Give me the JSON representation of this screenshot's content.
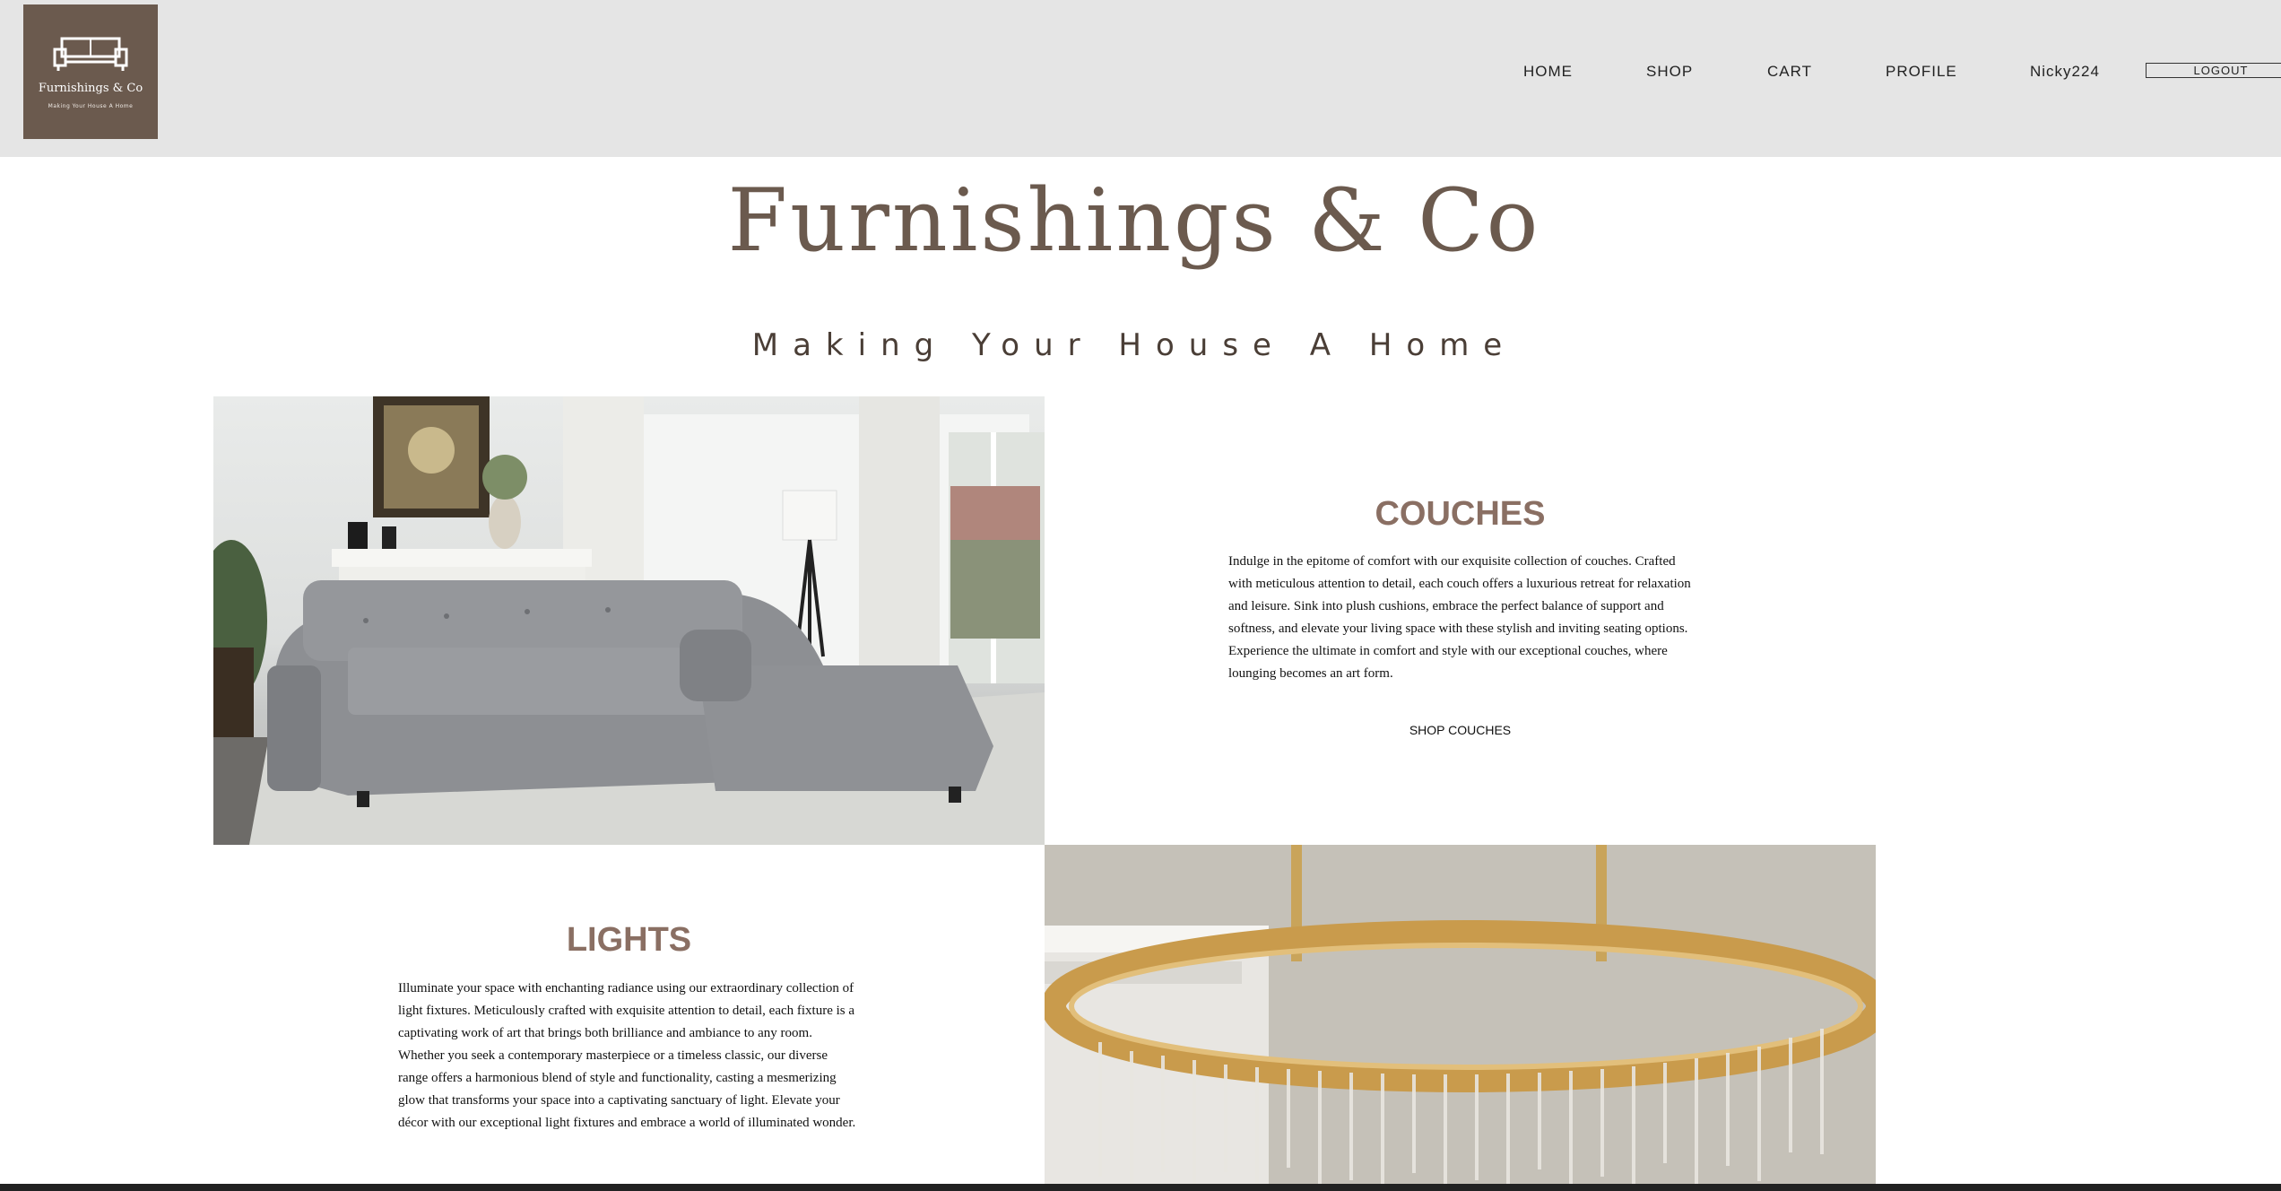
{
  "logo": {
    "name": "Furnishings & Co",
    "tagline": "Making Your House A Home"
  },
  "nav": {
    "home": "HOME",
    "shop": "SHOP",
    "cart": "CART",
    "profile": "PROFILE",
    "user": "Nicky224",
    "logout": "LOGOUT"
  },
  "hero": {
    "brand": "Furnishings & Co",
    "slogan": "Making Your House A Home"
  },
  "couches": {
    "title": "COUCHES",
    "text": "Indulge in the epitome of comfort with our exquisite collection of couches. Crafted with meticulous attention to detail, each couch offers a luxurious retreat for relaxation and leisure. Sink into plush cushions, embrace the perfect balance of support and softness, and elevate your living space with these stylish and inviting seating options. Experience the ultimate in comfort and style with our exceptional couches, where lounging becomes an art form.",
    "link": "SHOP COUCHES"
  },
  "lights": {
    "title": "LIGHTS",
    "text": "Illuminate your space with enchanting radiance using our extraordinary collection of light fixtures. Meticulously crafted with exquisite attention to detail, each fixture is a captivating work of art that brings both brilliance and ambiance to any room. Whether you seek a contemporary masterpiece or a timeless classic, our diverse range offers a harmonious blend of style and functionality, casting a mesmerizing glow that transforms your space into a captivating sanctuary of light. Elevate your décor with our exceptional light fixtures and embrace a world of illuminated wonder."
  },
  "colors": {
    "header_bg": "#e5e5e5",
    "brand": "#6b5a4e",
    "section_title": "#8a6f63"
  }
}
